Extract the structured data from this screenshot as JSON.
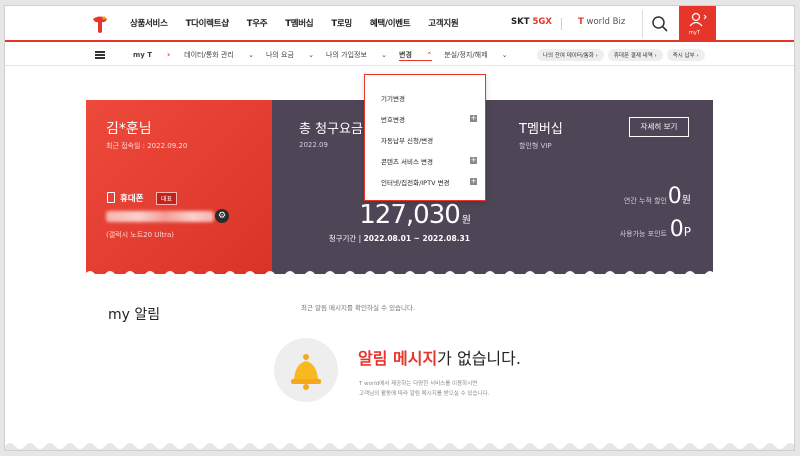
{
  "header": {
    "nav": [
      "상품서비스",
      "T다이렉트샵",
      "T우주",
      "T멤버십",
      "T로밍",
      "혜택/이벤트",
      "고객지원"
    ],
    "brand_5gx_prefix": "SKT",
    "brand_5gx": "5GX",
    "brand_worldbiz_prefix": "T",
    "brand_worldbiz": "world Biz",
    "myt_label": "myT",
    "accent_color": "#e6362b"
  },
  "subnav": {
    "home": "my T",
    "items": [
      "데이터/통화 관리",
      "나의 요금",
      "나의 가입정보",
      "변경",
      "분실/정지/해제"
    ],
    "chips": [
      "나의 잔여 데이터/통화",
      "휴대폰 결제 내역",
      "즉시 납부"
    ]
  },
  "dropdown": {
    "items": [
      "기기변경",
      "번호변경",
      "자동납부 신청/변경",
      "콘텐츠 서비스 변경",
      "인터넷/집전화/IPTV 변경"
    ]
  },
  "user": {
    "name": "김*훈님",
    "recent_login": "최근 접속일 : 2022.09.20",
    "phone_label": "휴대폰",
    "rep_badge": "대표",
    "device": "(갤럭시 노트20 Ultra)"
  },
  "bill": {
    "title": "총 청구요금",
    "month": "2022.09",
    "amount": "127,030",
    "unit": "원",
    "period_label": "청구기간 |",
    "period": "2022.08.01 ~ 2022.08.31"
  },
  "membership": {
    "title": "T멤버십",
    "grade": "할인형 VIP",
    "detail_button": "자세히 보기",
    "discount_label": "연간 누적 할인",
    "discount_value": "0",
    "discount_unit": "원",
    "point_label": "사용가능 포인트",
    "point_value": "0",
    "point_unit": "P"
  },
  "notice": {
    "title": "my 알림",
    "desc": "최근 알림 메시지를 확인하실 수 있습니다.",
    "empty_highlight": "알림 메시지",
    "empty_rest": "가 없습니다.",
    "sub1": "T world에서 제공하는 다양한 서비스를 이용하시면",
    "sub2": "고객님의 활동에 따라 알림 메시지를 받으실 수 있습니다."
  }
}
